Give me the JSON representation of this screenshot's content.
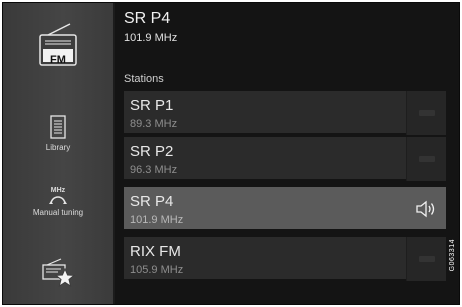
{
  "sidebar": {
    "fm": {
      "label": "FM",
      "icon": "fm-radio-icon"
    },
    "library": {
      "label": "Library",
      "icon": "library-icon"
    },
    "manual_tuning": {
      "mhz": "MHz",
      "label": "Manual tuning",
      "icon": "tuning-dial-icon"
    },
    "favorites": {
      "icon": "favorite-radio-icon"
    }
  },
  "now_playing": {
    "station": "SR P4",
    "frequency": "101.9 MHz"
  },
  "stations": {
    "label": "Stations",
    "items": [
      {
        "name": "SR P1",
        "frequency": "89.3 MHz",
        "active": false
      },
      {
        "name": "SR P2",
        "frequency": "96.3 MHz",
        "active": false
      },
      {
        "name": "SR P4",
        "frequency": "101.9 MHz",
        "active": true
      },
      {
        "name": "RIX FM",
        "frequency": "105.9 MHz",
        "active": false
      }
    ]
  },
  "figure_code": "G063314",
  "colors": {
    "background": "#141414",
    "sidebar": "#424242",
    "row": "#2b2b2b",
    "row_active": "#5b5b5b"
  }
}
